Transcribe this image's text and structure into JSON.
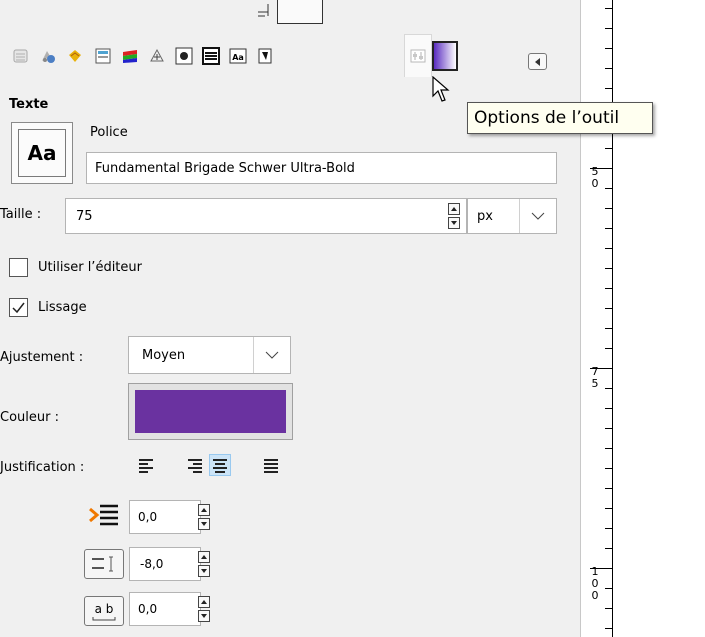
{
  "toolbar": {
    "tabs": [
      {
        "name": "layers-tab-icon"
      },
      {
        "name": "channels-tab-icon"
      },
      {
        "name": "paths-tab-icon"
      },
      {
        "name": "colormap-tab-icon"
      },
      {
        "name": "histogram-tab-icon"
      },
      {
        "name": "navigation-tab-icon"
      },
      {
        "name": "brushes-tab-icon"
      },
      {
        "name": "patterns-tab-icon"
      },
      {
        "name": "fonts-tab-icon"
      },
      {
        "name": "document-history-tab-icon"
      },
      {
        "name": "tool-options-tab-icon"
      },
      {
        "name": "gradients-tab-icon"
      }
    ],
    "tooltip": "Options de l’outil"
  },
  "section_title": "Texte",
  "font": {
    "label": "Police",
    "button_text": "Aa",
    "value": "Fundamental  Brigade Schwer Ultra-Bold"
  },
  "size": {
    "label": "Taille :",
    "value": "75",
    "unit": "px"
  },
  "use_editor": {
    "label": "Utiliser l’éditeur",
    "checked": false
  },
  "antialias": {
    "label": "Lissage",
    "checked": true
  },
  "hinting": {
    "label": "Ajustement :",
    "value": "Moyen"
  },
  "color": {
    "label": "Couleur :",
    "value": "#6a32a0"
  },
  "justification": {
    "label": "Justification :",
    "options": [
      "left",
      "right",
      "center",
      "fill"
    ],
    "selected": "center"
  },
  "indent": {
    "value": "0,0"
  },
  "line_spacing": {
    "value": "-8,0"
  },
  "letter_spacing": {
    "value": "0,0"
  },
  "ruler": {
    "labels": [
      "5",
      "0",
      "7",
      "5",
      "1",
      "0",
      "0"
    ]
  }
}
